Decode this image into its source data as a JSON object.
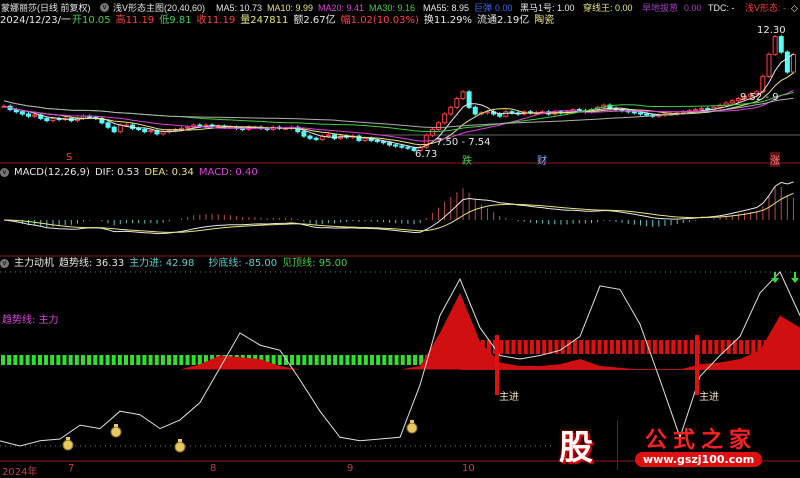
{
  "header": {
    "stock_name": "蒙娜丽莎(日线 前复权)",
    "main_indicator": "浅V形态主图(20,40,60)",
    "ma5": "MA5: 10.73",
    "ma10": "MA10: 9.99",
    "ma20": "MA20: 9.41",
    "ma30": "MA30: 9.16",
    "ma55": "MA55: 8.95",
    "jd_label": "巨弹",
    "jd_value": "0.00",
    "hm": "黑马1号: 1.00",
    "cxw": "穿线王: 0.00",
    "hdbc_label": "旱地拔葱",
    "hdbc_value": "0.00",
    "tdc": "TDC: -",
    "qv": "浅V形态: -"
  },
  "quote": {
    "date": "2024/12/23/一",
    "open": "开10.05",
    "high": "高11.19",
    "low": "低9.81",
    "close": "收11.19",
    "volume": "量247811",
    "amount": "额2.67亿",
    "change": "幅1.02(10.03%)",
    "turnover": "换11.29%",
    "float": "流通2.19亿",
    "sector": "陶瓷"
  },
  "macd_header": {
    "title": "MACD(12,26,9)",
    "dif": "DIF: 0.53",
    "dea": "DEA: 0.34",
    "macd": "MACD: 0.40"
  },
  "zl_header": {
    "title": "主力动机",
    "trend": "趋势线: 36.33",
    "zlj": "主力进: 42.98",
    "cdx": "抄底线: -85.00",
    "jdx": "见顶线: 95.00"
  },
  "zl_legend": "趋势线: 主力",
  "annotations": {
    "high_price": "12.30",
    "range": "7.50 - 7.54",
    "low_price": "6.73",
    "right_range": "9.52 - 9",
    "s": "S",
    "die": "跌",
    "cai": "财",
    "zhang": "涨",
    "zj1": "主进",
    "zj2": "主进"
  },
  "x_axis": [
    "2024年",
    "7",
    "8",
    "9",
    "10"
  ],
  "watermark": {
    "logo": "股",
    "name": "公式之家",
    "url": "www.gszj100.com"
  },
  "colors": {
    "up": "#ff4040",
    "down": "#54ffff",
    "ma5": "#e8e8e8",
    "ma10": "#e6e67a",
    "ma20": "#e040e0",
    "ma30": "#40d040",
    "ma55": "#b0b0b0"
  },
  "chart_data": {
    "type": "candlestick",
    "title": "蒙娜丽莎 日线",
    "closes": [
      8.85,
      8.7,
      8.6,
      8.5,
      8.4,
      8.45,
      8.3,
      8.2,
      8.3,
      8.25,
      8.3,
      8.2,
      8.3,
      8.4,
      8.35,
      8.3,
      8.1,
      7.9,
      7.7,
      8.0,
      8.0,
      7.85,
      7.8,
      7.7,
      7.75,
      7.6,
      7.7,
      7.75,
      7.8,
      7.85,
      7.9,
      8.0,
      7.95,
      8.0,
      7.95,
      7.95,
      7.9,
      7.9,
      7.85,
      7.8,
      7.9,
      7.9,
      7.85,
      7.8,
      7.9,
      7.85,
      7.85,
      7.9,
      7.7,
      7.5,
      7.4,
      7.35,
      7.5,
      7.55,
      7.4,
      7.5,
      7.45,
      7.5,
      7.3,
      7.4,
      7.3,
      7.25,
      7.2,
      7.1,
      7.05,
      7.0,
      6.95,
      6.85,
      7.0,
      7.54,
      7.8,
      8.1,
      8.5,
      8.8,
      9.2,
      9.5,
      8.8,
      8.5,
      8.55,
      8.6,
      8.5,
      8.4,
      8.6,
      8.55,
      8.5,
      8.6,
      8.55,
      8.55,
      8.6,
      8.5,
      8.6,
      8.55,
      8.6,
      8.7,
      8.65,
      8.6,
      8.7,
      8.8,
      8.9,
      8.75,
      8.7,
      8.65,
      8.6,
      8.55,
      8.5,
      8.45,
      8.4,
      8.45,
      8.5,
      8.5,
      8.55,
      8.6,
      8.65,
      8.7,
      8.75,
      8.7,
      8.8,
      8.9,
      9.0,
      9.1,
      9.2,
      9.3,
      9.4,
      9.5,
      10.2,
      11.2,
      12.0,
      11.3,
      10.4,
      11.19
    ],
    "price_range": [
      6.3,
      12.7
    ],
    "trend_line": [
      3,
      0,
      3,
      4,
      12,
      10,
      20,
      18,
      10,
      15,
      25,
      45,
      65,
      58,
      55,
      38,
      20,
      5,
      3,
      4,
      5,
      35,
      75,
      96,
      68,
      52,
      50,
      52,
      55,
      63,
      92,
      90,
      70,
      38,
      5,
      40,
      52,
      63,
      88,
      100,
      75
    ],
    "main_force": [
      0,
      0,
      0,
      0,
      0,
      0,
      0,
      0,
      0,
      0,
      47,
      52,
      51,
      50,
      46,
      0,
      0,
      0,
      0,
      0,
      0,
      46,
      65,
      88,
      60,
      48,
      46,
      46,
      47,
      50,
      46,
      45,
      0,
      0,
      0,
      47,
      48,
      50,
      55,
      75,
      68
    ],
    "indicator_range": [
      0,
      100
    ]
  }
}
